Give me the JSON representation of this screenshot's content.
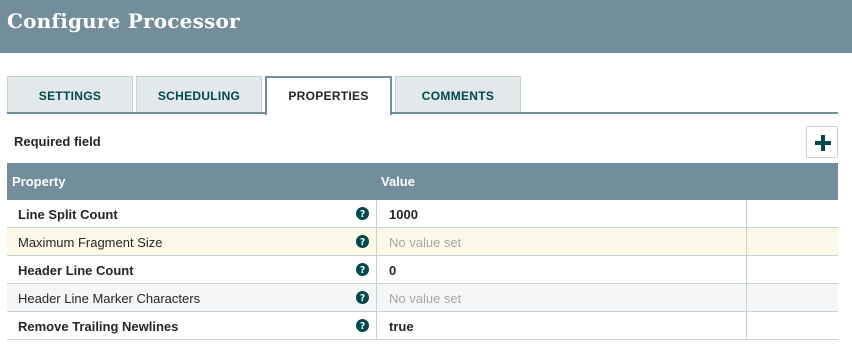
{
  "header": {
    "title": "Configure Processor"
  },
  "tabs": [
    {
      "label": "SETTINGS",
      "active": false
    },
    {
      "label": "SCHEDULING",
      "active": false
    },
    {
      "label": "PROPERTIES",
      "active": true
    },
    {
      "label": "COMMENTS",
      "active": false
    }
  ],
  "required_label": "Required field",
  "add_button_icon": "plus-icon",
  "grid": {
    "columns": [
      "Property",
      "Value"
    ],
    "rows": [
      {
        "name": "Line Split Count",
        "required": true,
        "value": "1000",
        "empty": false
      },
      {
        "name": "Maximum Fragment Size",
        "required": false,
        "value": "No value set",
        "empty": true
      },
      {
        "name": "Header Line Count",
        "required": true,
        "value": "0",
        "empty": false
      },
      {
        "name": "Header Line Marker Characters",
        "required": false,
        "value": "No value set",
        "empty": true
      },
      {
        "name": "Remove Trailing Newlines",
        "required": true,
        "value": "true",
        "empty": false
      }
    ]
  },
  "colors": {
    "header_bg": "#728e9b",
    "tab_text": "#004849",
    "help_icon": "#004849"
  }
}
